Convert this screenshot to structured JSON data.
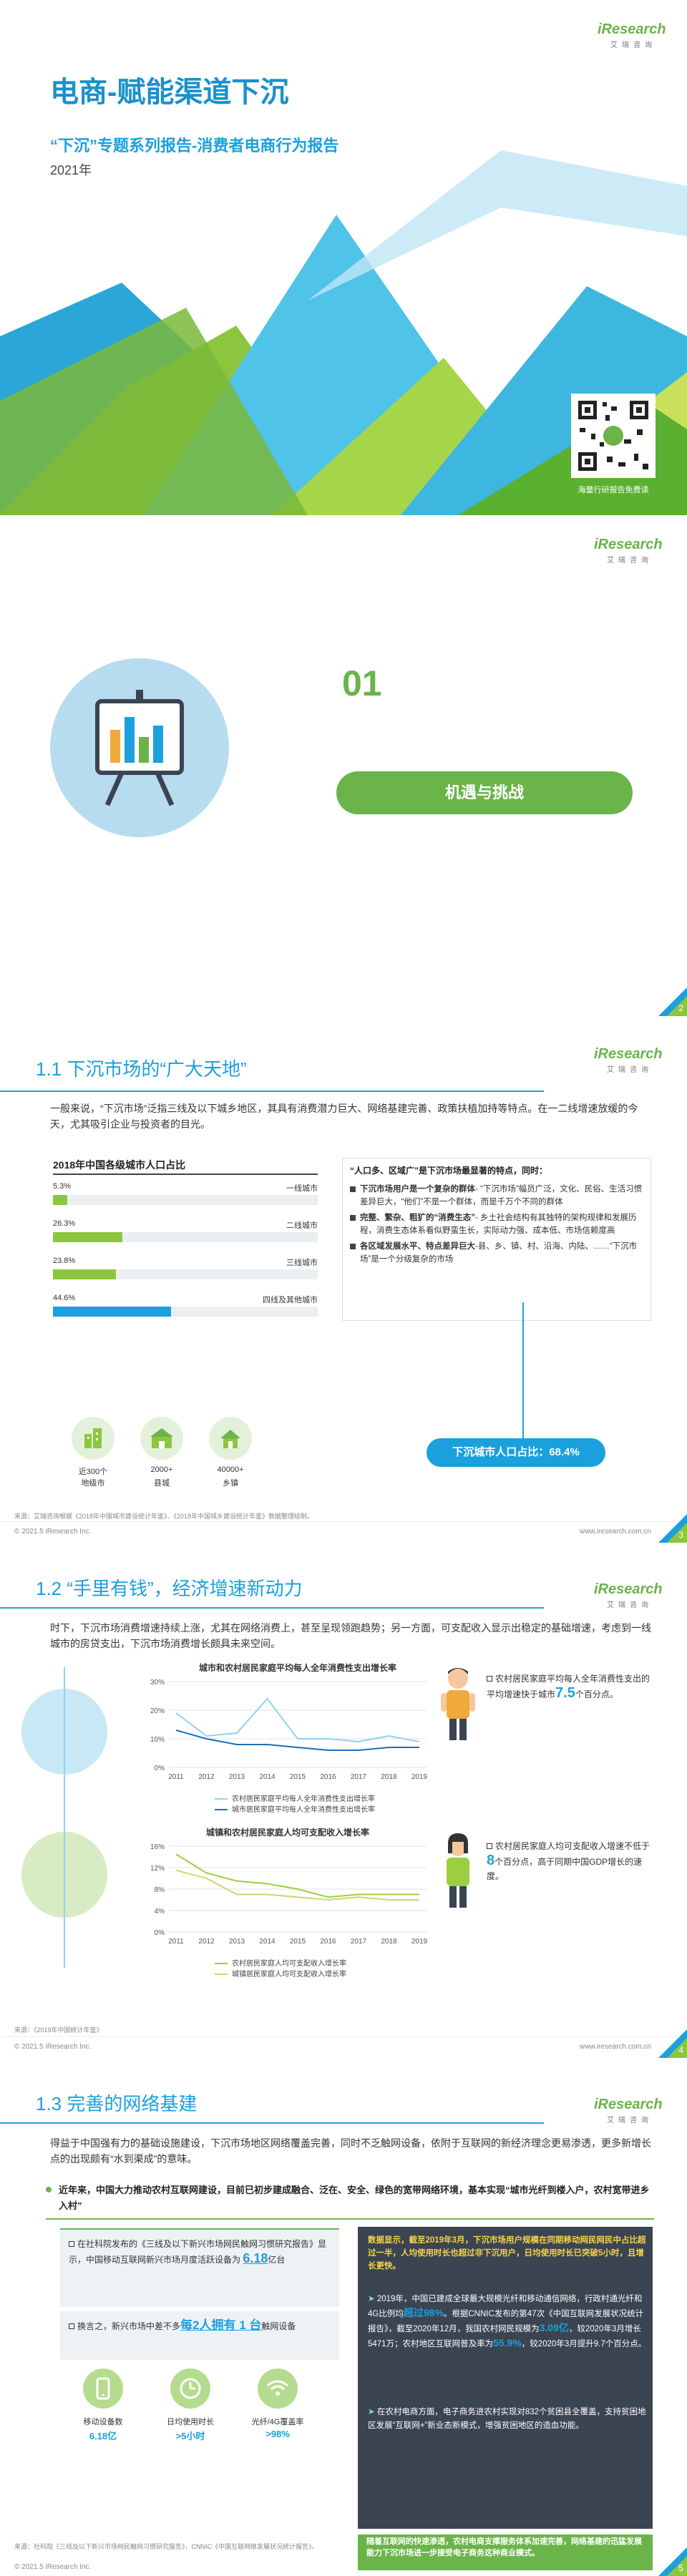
{
  "cover": {
    "title": "电商-赋能渠道下沉",
    "subtitle": "“下沉”专题系列报告-消费者电商行为报告",
    "year": "2021年",
    "brand": "iResearch",
    "brand_cn": "艾瑞咨询",
    "qr_caption": "海量行研报告免费读"
  },
  "chapter": {
    "number": "01",
    "label": "机遇与挑战",
    "page": "2"
  },
  "s1": {
    "title": "1.1 下沉市场的“广大天地”",
    "intro": "一般来说，“下沉市场”泛指三线及以下城乡地区，其具有消费潜力巨大、网络基建完善、政策扶植加持等特点。在一二线增速放缓的今天，尤其吸引企业与投资者的目光。",
    "chart_title": "2018年中国各级城市人口占比",
    "chart_data": {
      "type": "bar",
      "title": "2018年中国各级城市人口占比",
      "categories": [
        "一线城市",
        "二线城市",
        "三线城市",
        "四线及其他城市"
      ],
      "values": [
        5.3,
        26.3,
        23.8,
        44.6
      ],
      "value_labels": [
        "5.3%",
        "26.3%",
        "23.8%",
        "44.6%"
      ],
      "xlim": [
        0,
        100
      ]
    },
    "right_title": "“人口多、区域广”是下沉市场最显著的特点，同时：",
    "right_items": [
      {
        "bold": "下沉市场用户是一个复杂的群体",
        "text": "- “下沉市场”幅员广泛，文化、民俗、生活习惯差异巨大，“他们”不是一个群体，而是千万个不同的群体"
      },
      {
        "bold": "完整、繁杂、粗犷的“消费生态”",
        "text": "- 乡土社会结构有其独特的架构规律和发展历程，消费生态体系看似野蛮生长，实际动力强、成本低、市场信赖度高"
      },
      {
        "bold": "各区域发展水平、特点差异巨大",
        "text": "-县、乡、镇、村、沿海、内陆、……“下沉市场”是一个分级复杂的市场"
      }
    ],
    "stats": [
      {
        "value": "近300个",
        "label": "地级市",
        "icon": "city-icon"
      },
      {
        "value": "2000+",
        "label": "县城",
        "icon": "town-icon"
      },
      {
        "value": "40000+",
        "label": "乡镇",
        "icon": "house-icon"
      }
    ],
    "callout": "下沉城市人口占比：68.4%",
    "source": "来源：艾瑞咨询根据《2018年中国城市建设统计年鉴》、《2018年中国城乡建设统计年鉴》数据整理绘制。",
    "copyright": "© 2021.5 iResearch Inc.",
    "site": "www.iresearch.com.cn",
    "page": "3"
  },
  "s2": {
    "title": "1.2 “手里有钱”，经济增速新动力",
    "intro": "时下，下沉市场消费增速持续上涨，尤其在网络消费上，甚至呈现领跑趋势；另一方面，可支配收入显示出稳定的基础增速，考虑到一线城市的房贷支出，下沉市场消费增长颇具未来空间。",
    "chart1_title": "城市和农村居民家庭平均每人全年消费性支出增长率",
    "chart1_data": {
      "type": "line",
      "title": "城市和农村居民家庭平均每人全年消费性支出增长率",
      "categories": [
        "2011",
        "2012",
        "2013",
        "2014",
        "2015",
        "2016",
        "2017",
        "2018",
        "2019"
      ],
      "ylim": [
        0,
        30
      ],
      "yticks": [
        "0%",
        "10%",
        "20%",
        "30%"
      ],
      "series": [
        {
          "name": "农村居民家庭平均每人全年消费性支出增长率",
          "values": [
            19,
            11,
            12,
            24,
            10,
            10,
            9,
            11,
            9
          ],
          "color": "#8fd3f0"
        },
        {
          "name": "城市居民家庭平均每人全年消费性支出增长率",
          "values": [
            13,
            10,
            8,
            8,
            7,
            6,
            6,
            7,
            7
          ],
          "color": "#1a6fb5"
        }
      ]
    },
    "note1_pre": "农村居民家庭平均每人全年消费性支出的平均增速快于城市",
    "note1_num": "7.5",
    "note1_post": "个百分点。",
    "chart2_title": "城镇和农村居民家庭人均可支配收入增长率",
    "chart2_data": {
      "type": "line",
      "title": "城镇和农村居民家庭人均可支配收入增长率",
      "categories": [
        "2011",
        "2012",
        "2013",
        "2014",
        "2015",
        "2016",
        "2017",
        "2018",
        "2019"
      ],
      "ylim": [
        0,
        16
      ],
      "yticks": [
        "0%",
        "4%",
        "8%",
        "12%",
        "16%"
      ],
      "series": [
        {
          "name": "农村居民家庭人均可支配收入增长率",
          "values": [
            14.5,
            11,
            9.5,
            9,
            8,
            6.5,
            7,
            7,
            7
          ],
          "color": "#9ccf3f"
        },
        {
          "name": "城镇居民家庭人均可支配收入增长率",
          "values": [
            11.5,
            10,
            7,
            7,
            6.5,
            6,
            6.5,
            6,
            6
          ],
          "color": "#c9d96a"
        }
      ]
    },
    "note2_pre": "农村居民家庭人均可支配收入增速不低于",
    "note2_num": "8",
    "note2_post": "个百分点，高于同期中国GDP增长的速度。",
    "source": "来源：《2019年中国统计年鉴》",
    "copyright": "© 2021.5 iResearch Inc.",
    "site": "www.iresearch.com.cn",
    "page": "4"
  },
  "s3": {
    "title": "1.3 完善的网络基建",
    "intro": "得益于中国强有力的基础设施建设，下沉市场地区网络覆盖完善，同时不乏触网设备，依附于互联网的新经济理念更易渗透，更多新增长点的出现颇有“水到渠成”的意味。",
    "banner": "近年来，中国大力推动农村互联网建设，目前已初步建成融合、泛在、安全、绿色的宽带网络环境，基本实现“城市光纤到楼入户，农村宽带进乡入村”",
    "left1_pre": "在社科院发布的《三线及以下新兴市场网民触网习惯研究报告》显示，中国移动互联网新兴市场月度活跃设备为",
    "left1_num": "6.18",
    "left1_post": "亿台",
    "left2_pre": "换言之，新兴市场中差不多",
    "left2_num": "每2人拥有 1 台",
    "left2_post": "触网设备",
    "stats": [
      {
        "label": "移动设备数",
        "value": "6.18亿",
        "icon": "phone-icon"
      },
      {
        "label": "日均使用时长",
        "value": ">5小时",
        "icon": "clock-icon"
      },
      {
        "label": "光纤/4G覆盖率",
        "value": ">98%",
        "icon": "wifi-icon"
      }
    ],
    "right_head": "数据显示，截至2019年3月，下沉市场用户规模在同期移动网民网民中占比超过一半，人均使用时长也超过非下沉用户，日均使用时长已突破5小时，且增长更快。",
    "right_b1_pre": "2019年，中国已建成全球最大规模光纤和移动通信网络，行政村通光纤和4G比例均",
    "right_b1_hl": "超过98%",
    "right_b1_post": "。根据CNNIC发布的第47次《中国互联网发展状况统计报告》，截至2020年12月，我国农村网民规模为",
    "right_b1_num": "3.09亿",
    "right_b1_post2": "，较2020年3月增长5471万；农村地区互联网普及率为",
    "right_b1_num2": "55.9%",
    "right_b1_post3": "，较2020年3月提升9.7个百分点。",
    "right_b2": "在农村电商方面，电子商务进农村实现对832个贫困县全覆盖，支持贫困地区发展“互联网+”新业态新模式，增强贫困地区的造血功能。",
    "right_bottom": "随着互联网的快速渗透，农村电商支撑服务体系加速完善，网络基建的迅猛发展能力下沉市场进一步接受电子商务这种商业模式。",
    "source": "来源：社科院《三线及以下新兴市场网民触网习惯研究报告》，CNNIC《中国互联网络发展状况统计报告》。",
    "copyright": "© 2021.5 iResearch Inc.",
    "site": "www.iresearch.com.cn",
    "page": "5"
  }
}
